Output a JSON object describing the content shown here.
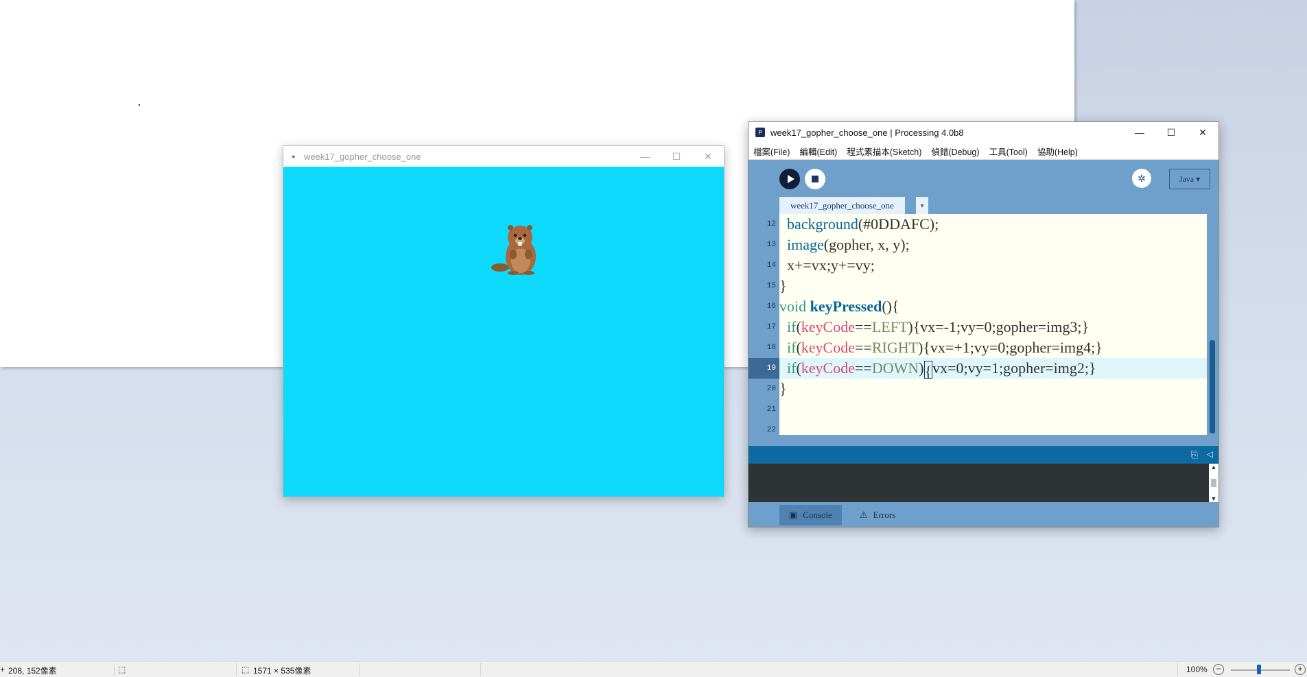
{
  "sketch_window": {
    "title": "week17_gopher_choose_one",
    "background_color": "#0DDAFC",
    "controls": {
      "minimize": "—",
      "maximize": "☐",
      "close": "✕"
    }
  },
  "ide": {
    "title": "week17_gopher_choose_one | Processing 4.0b8",
    "controls": {
      "minimize": "—",
      "maximize": "☐",
      "close": "✕"
    },
    "menu": [
      "檔案(File)",
      "編輯(Edit)",
      "程式素描本(Sketch)",
      "偵錯(Debug)",
      "工具(Tool)",
      "協助(Help)"
    ],
    "mode": "Java ▾",
    "tab_name": "week17_gopher_choose_one",
    "tab_menu": "▾",
    "line_numbers": [
      "12",
      "13",
      "14",
      "15",
      "16",
      "17",
      "18",
      "19",
      "20",
      "21",
      "22"
    ],
    "code": {
      "l12a": "  ",
      "l12b": "background",
      "l12c": "(#0DDAFC);",
      "l13a": "  ",
      "l13b": "image",
      "l13c": "(gopher, x, y);",
      "l14": "  x+=vx;y+=vy;",
      "l15": "}",
      "l16a": "void",
      "l16b": " ",
      "l16c": "keyPressed",
      "l16d": "(){",
      "l17a": "  ",
      "l17b": "if",
      "l17c": "(",
      "l17d": "keyCode",
      "l17e": "==",
      "l17f": "LEFT",
      "l17g": "){vx=-1;vy=0;gopher=img3;}",
      "l18a": "  ",
      "l18b": "if",
      "l18c": "(",
      "l18d": "keyCode",
      "l18e": "==",
      "l18f": "RIGHT",
      "l18g": "){vx=+1;vy=0;gopher=img4;}",
      "l19a": "  ",
      "l19b": "if",
      "l19c": "(",
      "l19d": "keyCode",
      "l19e": "==",
      "l19f": "DOWN",
      "l19g": ")",
      "l19h": "{",
      "l19i": "vx=0;vy=1;gopher=img2;}",
      "l20": "}"
    },
    "console_tab": "Console",
    "errors_tab": "Errors"
  },
  "paint_status": {
    "cursor_pos": "208, 152像素",
    "selection_size": "",
    "image_size": "1571 × 535像素",
    "zoom": "100%"
  }
}
